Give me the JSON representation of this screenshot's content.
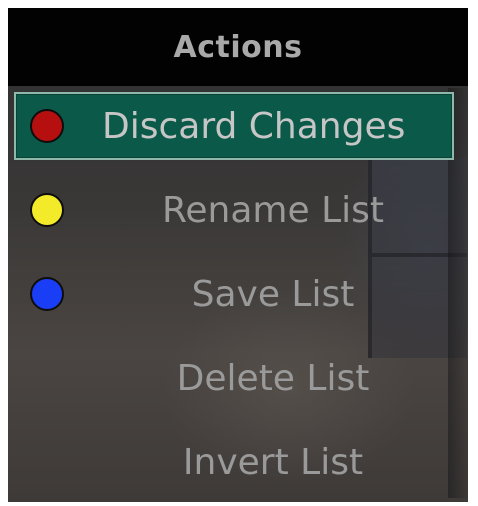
{
  "dialog": {
    "title": "Actions"
  },
  "menu": {
    "items": [
      {
        "label": "Discard Changes",
        "key_color": "red",
        "color_hex": "#b50f0f",
        "selected": true
      },
      {
        "label": "Rename List",
        "key_color": "yellow",
        "color_hex": "#f3ea2a",
        "selected": false
      },
      {
        "label": "Save List",
        "key_color": "blue",
        "color_hex": "#1a3ef5",
        "selected": false
      },
      {
        "label": "Delete List",
        "key_color": "",
        "color_hex": "",
        "selected": false
      },
      {
        "label": "Invert List",
        "key_color": "",
        "color_hex": "",
        "selected": false
      }
    ]
  },
  "colors": {
    "header_bg": "#020202",
    "selection_bg": "#0b5a49",
    "selection_border": "#8fb8ab",
    "text": "#9a9a9a",
    "title_text": "#a9a9a9"
  }
}
